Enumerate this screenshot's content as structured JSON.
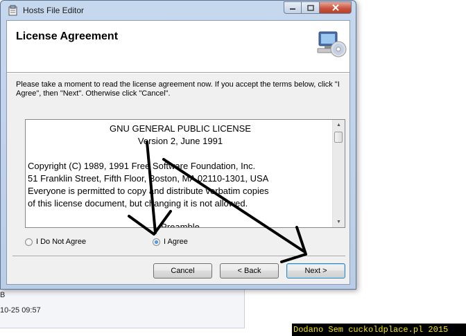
{
  "window": {
    "title": "Hosts File Editor"
  },
  "header": {
    "title": "License Agreement"
  },
  "intro": {
    "text": "Please take a moment to read the license agreement now. If you accept the terms below, click \"I Agree\", then \"Next\". Otherwise click \"Cancel\"."
  },
  "license": {
    "heading": "GNU GENERAL PUBLIC LICENSE",
    "version": "Version 2, June 1991",
    "lines": [
      "Copyright (C) 1989, 1991 Free Software Foundation, Inc.",
      "51 Franklin Street, Fifth Floor, Boston, MA  02110-1301, USA",
      "Everyone is permitted to copy and distribute verbatim copies",
      "of this license document, but changing it is not allowed."
    ],
    "preamble": "Preamble"
  },
  "options": {
    "disagree_label": "I Do Not Agree",
    "agree_label": "I Agree",
    "selected": "I Agree"
  },
  "buttons": {
    "cancel": "Cancel",
    "back": "< Back",
    "next": "Next >"
  },
  "background": {
    "fragment_1": "B",
    "fragment_2": "10-25 09:57"
  },
  "watermark": "Dodano Sem cuckoldplace.pl 2015",
  "colors": {
    "watermark_bg": "#000000",
    "watermark_fg": "#f2e600",
    "title_bar": "#c6d8ee",
    "close_button": "#c8513d"
  }
}
